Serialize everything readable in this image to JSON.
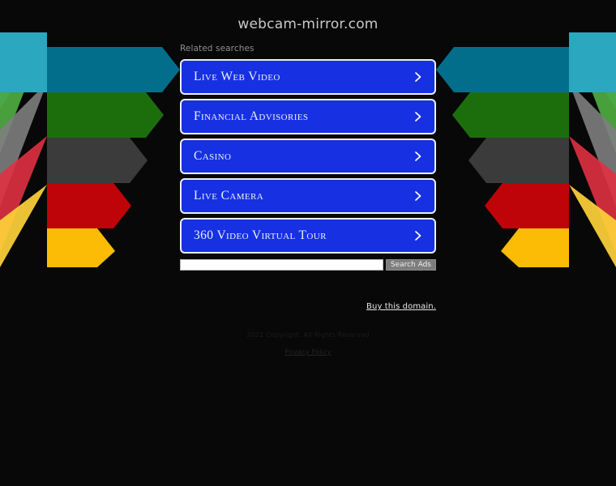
{
  "page": {
    "background_color": "#080808",
    "domain_title": "webcam-mirror.com"
  },
  "related": {
    "label": "Related searches",
    "items": [
      {
        "label": "Live Web Video",
        "icon": "chevron-right-icon"
      },
      {
        "label": "Financial Advisories",
        "icon": "chevron-right-icon"
      },
      {
        "label": "Casino",
        "icon": "chevron-right-icon"
      },
      {
        "label": "Live Camera",
        "icon": "chevron-right-icon"
      },
      {
        "label": "360 Video Virtual Tour",
        "icon": "chevron-right-icon"
      }
    ],
    "button_color": "#1630E2",
    "button_border_color": "#eceff5",
    "button_text_color": "#eef0fa"
  },
  "search": {
    "value": "",
    "placeholder": "",
    "button_label": "Search Ads"
  },
  "purchase": {
    "buy_label": "Buy this domain."
  },
  "footer": {
    "copyright": "2021 Copyright. All Rights Reserved",
    "privacy_label": "Privacy Policy"
  },
  "decoration": {
    "name": "arrow-band-graphic",
    "rows": [
      {
        "name": "teal",
        "main": "#036E8B",
        "light": "#2BA8BF",
        "mid": "#1B8B8A"
      },
      {
        "name": "green",
        "main": "#1C6E0D",
        "light": "#4CA83F",
        "mid": "#368B26"
      },
      {
        "name": "gray",
        "main": "#3B3B3B",
        "light": "#7E7E7E",
        "mid": "#5C5C5C"
      },
      {
        "name": "red",
        "main": "#BE0309",
        "light": "#E03142",
        "mid": "#A41A26"
      },
      {
        "name": "yellow",
        "main": "#FCBB04",
        "light": "#FFD23A",
        "mid": "#EE7B10"
      }
    ]
  }
}
